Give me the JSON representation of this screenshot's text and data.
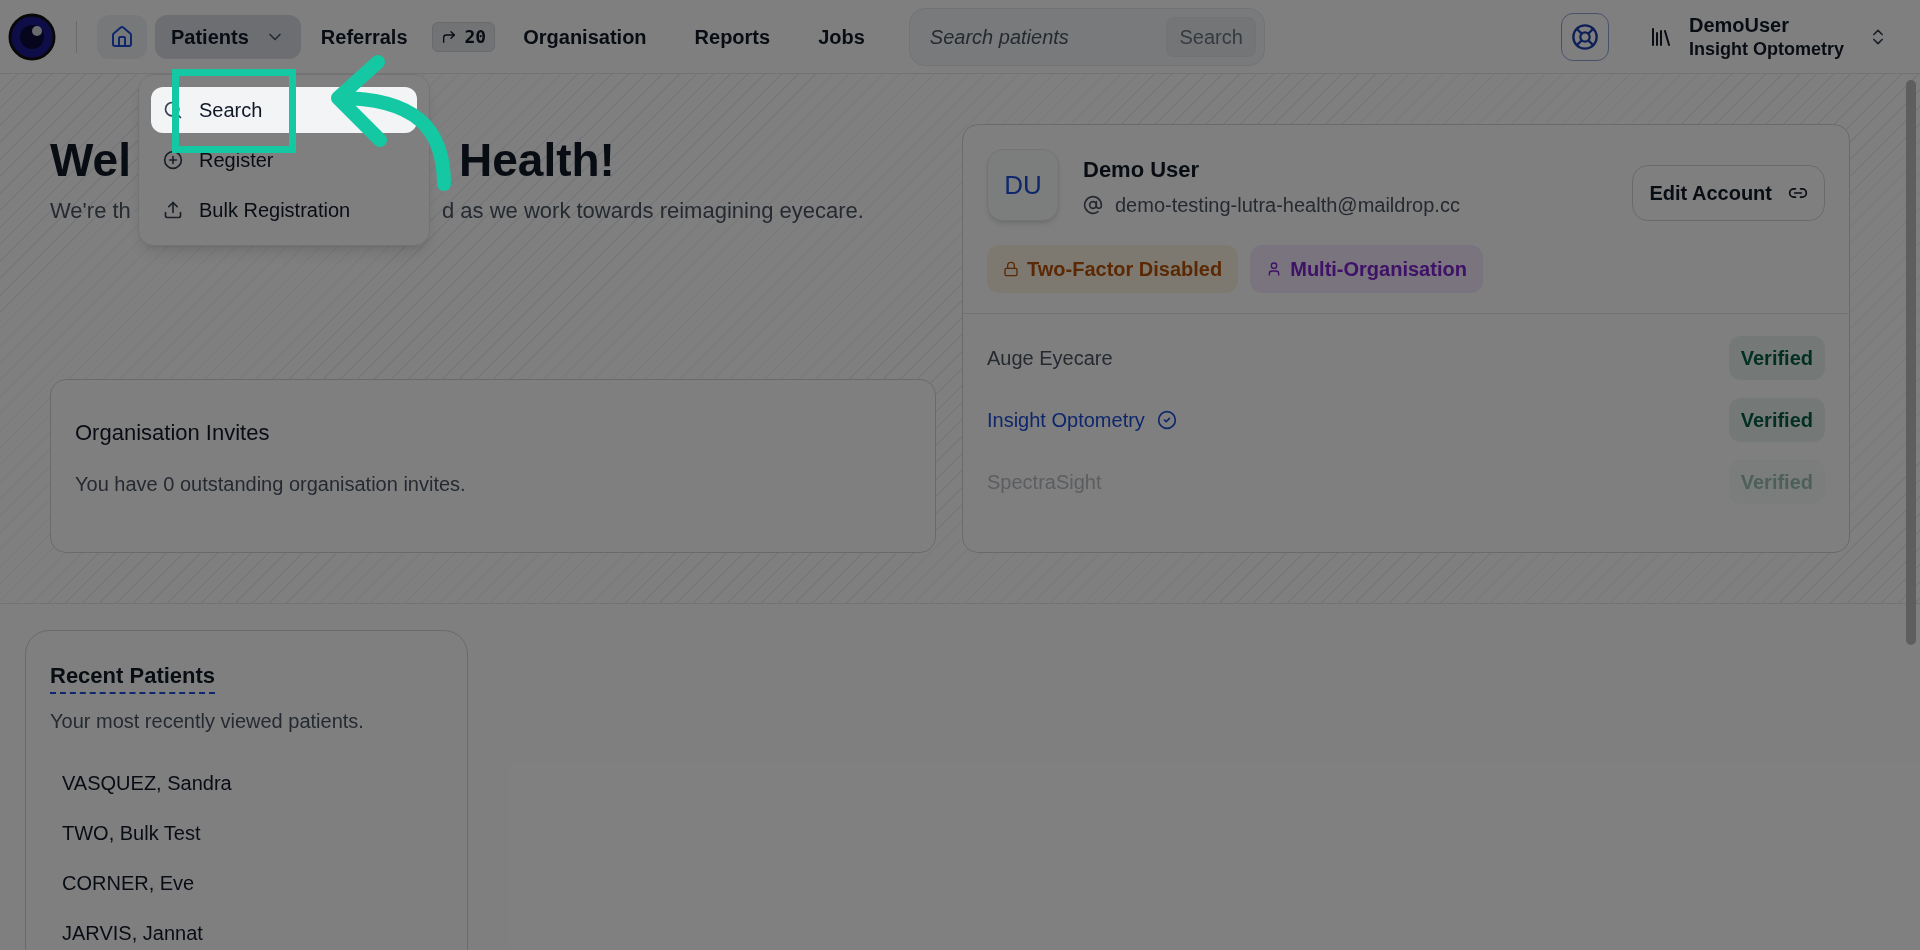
{
  "nav": {
    "items": [
      {
        "kind": "home"
      },
      {
        "kind": "dropdown",
        "label": "Patients",
        "expanded": true
      },
      {
        "kind": "badge",
        "label": "Referrals",
        "badge": "20"
      },
      {
        "kind": "link",
        "label": "Organisation"
      },
      {
        "kind": "link",
        "label": "Reports"
      },
      {
        "kind": "link",
        "label": "Jobs"
      }
    ],
    "search": {
      "placeholder": "Search patients",
      "button": "Search"
    },
    "user": {
      "name": "DemoUser",
      "organisation": "Insight Optometry"
    }
  },
  "patients_menu": {
    "items": [
      {
        "kind": "search",
        "label": "Search",
        "selected": true
      },
      {
        "kind": "register",
        "label": "Register",
        "selected": false
      },
      {
        "kind": "upload",
        "label": "Bulk Registration",
        "selected": false
      }
    ]
  },
  "welcome": {
    "heading_parts": [
      "Wel",
      "Health!"
    ],
    "subtitle_parts": [
      "We're th",
      "d as we work towards reimagining eyecare."
    ]
  },
  "invites": {
    "title": "Organisation Invites",
    "text": "You have 0 outstanding organisation invites."
  },
  "profile": {
    "initials": "DU",
    "name": "Demo User",
    "email": "demo-testing-lutra-health@maildrop.cc",
    "edit_button": "Edit Account",
    "badges": [
      {
        "kind": "lock",
        "label": "Two-Factor Disabled"
      },
      {
        "kind": "user",
        "label": "Multi-Organisation"
      }
    ],
    "organisations": [
      {
        "name": "Auge Eyecare",
        "current": false,
        "faded": false,
        "status": "Verified"
      },
      {
        "name": "Insight Optometry",
        "current": true,
        "faded": false,
        "status": "Verified"
      },
      {
        "name": "SpectraSight",
        "current": false,
        "faded": true,
        "status": "Verified"
      }
    ]
  },
  "recent_patients": {
    "title": "Recent Patients",
    "subtitle": "Your most recently viewed patients.",
    "patients": [
      "VASQUEZ, Sandra",
      "TWO, Bulk Test",
      "CORNER, Eve",
      "JARVIS, Jannat"
    ]
  }
}
